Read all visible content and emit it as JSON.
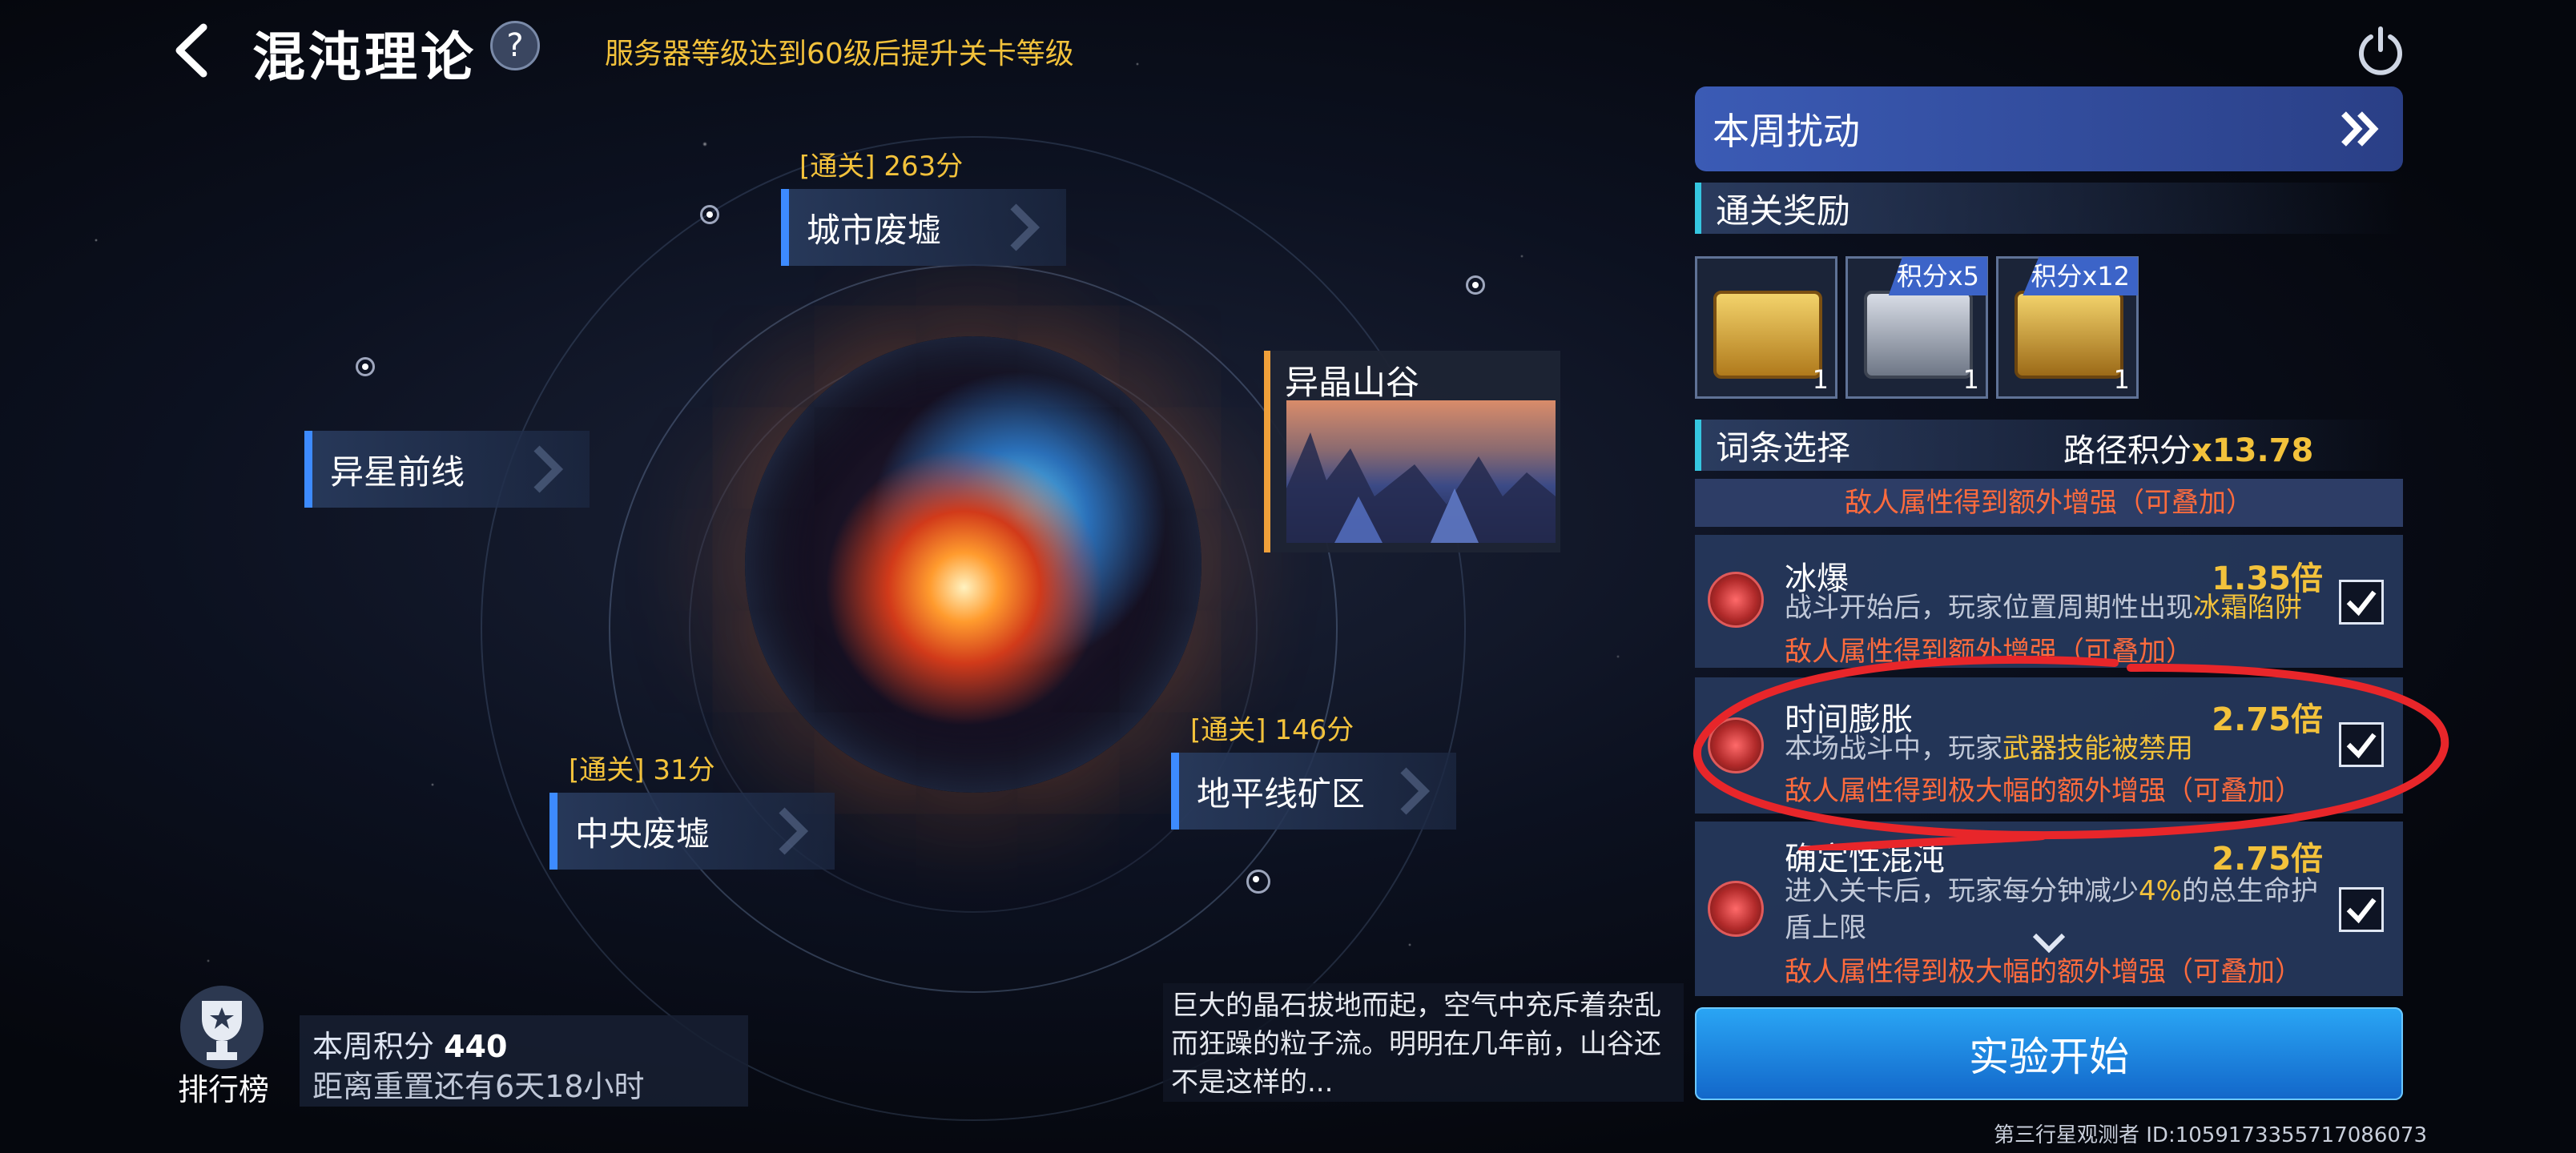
{
  "header": {
    "title": "混沌理论",
    "help": "?",
    "notice": "服务器等级达到60级后提升关卡等级"
  },
  "map": {
    "nodes": [
      {
        "label": "城市废墟",
        "clear": "[通关] 263分"
      },
      {
        "label": "异星前线",
        "clear": ""
      },
      {
        "label": "异晶山谷",
        "clear": ""
      },
      {
        "label": "中央废墟",
        "clear": "[通关] 31分"
      },
      {
        "label": "地平线矿区",
        "clear": "[通关] 146分"
      }
    ]
  },
  "panel": {
    "weekly_disturbance": "本周扰动",
    "rewards_title": "通关奖励",
    "rewards": [
      {
        "tag": "",
        "count": "1"
      },
      {
        "tag": "积分x5",
        "count": "1"
      },
      {
        "tag": "积分x12",
        "count": "1"
      }
    ],
    "affix_title": "词条选择",
    "path_score_label": "路径积分",
    "path_score_value": "x13.78",
    "top_bonus": "敌人属性得到额外增强（可叠加）",
    "affixes": [
      {
        "name": "冰爆",
        "multiplier": "1.35倍",
        "desc": "战斗开始后，玩家位置周期性出现",
        "desc_hl": "冰霜陷阱",
        "bonus": "敌人属性得到额外增强（可叠加）",
        "checked": true
      },
      {
        "name": "时间膨胀",
        "multiplier": "2.75倍",
        "desc": "本场战斗中，玩家",
        "desc_hl": "武器技能被禁用",
        "bonus": "敌人属性得到极大幅的额外增强（可叠加）",
        "checked": true
      },
      {
        "name": "确定性混沌",
        "multiplier": "2.75倍",
        "desc": "进入关卡后，玩家每分钟减少",
        "desc_hl": "4%",
        "desc_tail": "的总生命护盾上限",
        "bonus": "敌人属性得到极大幅的额外增强（可叠加）",
        "checked": true
      }
    ],
    "start_button": "实验开始"
  },
  "bottom": {
    "rank_label": "排行榜",
    "weekly_score_label": "本周积分",
    "weekly_score_value": "440",
    "reset_text": "距离重置还有6天18小时",
    "stage_desc": "巨大的晶石拔地而起，空气中充斥着杂乱而狂躁的粒子流。明明在几年前，山谷还不是这样的..."
  },
  "footer": {
    "watermark": "第三行星观测者 ID:1059173355717086073"
  },
  "colors": {
    "accent_gold": "#f3c23b",
    "bonus_red": "#ff6b3d",
    "start_blue": "#1e88e5",
    "annotation_red": "#e8262a"
  },
  "icons": [
    "back-icon",
    "help-icon",
    "power-icon",
    "double-chevron-icon",
    "chest-icon",
    "affix-icon",
    "checkbox-icon",
    "trophy-icon"
  ]
}
